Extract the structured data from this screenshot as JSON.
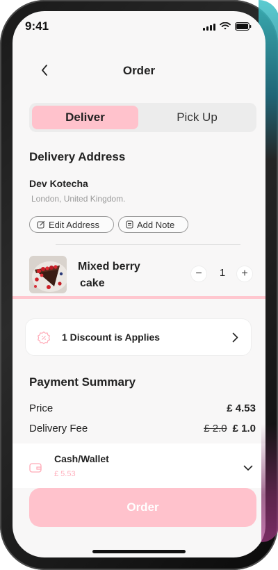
{
  "status_bar": {
    "time": "9:41"
  },
  "header": {
    "title": "Order"
  },
  "segments": {
    "deliver": "Deliver",
    "pickup": "Pick Up",
    "selected": "Deliver"
  },
  "delivery": {
    "heading": "Delivery Address",
    "name": "Dev Kotecha",
    "address": "London, United Kingdom.",
    "edit_label": "Edit Address",
    "note_label": "Add Note"
  },
  "item": {
    "name_line1": "Mixed berry",
    "name_line2": "cake",
    "quantity": "1",
    "minus": "−",
    "plus": "+"
  },
  "discount": {
    "text": "1 Discount is Applies"
  },
  "summary": {
    "heading": "Payment Summary",
    "price_label": "Price",
    "price_value": "£ 4.53",
    "fee_label": "Delivery Fee",
    "fee_original": "£ 2.0",
    "fee_value": "£ 1.0"
  },
  "payment": {
    "method": "Cash/Wallet",
    "balance": "£ 5.53"
  },
  "actions": {
    "order_label": "Order"
  },
  "colors": {
    "accent_pink": "#ffc2cc",
    "screen_bg": "#f8f7f7"
  }
}
